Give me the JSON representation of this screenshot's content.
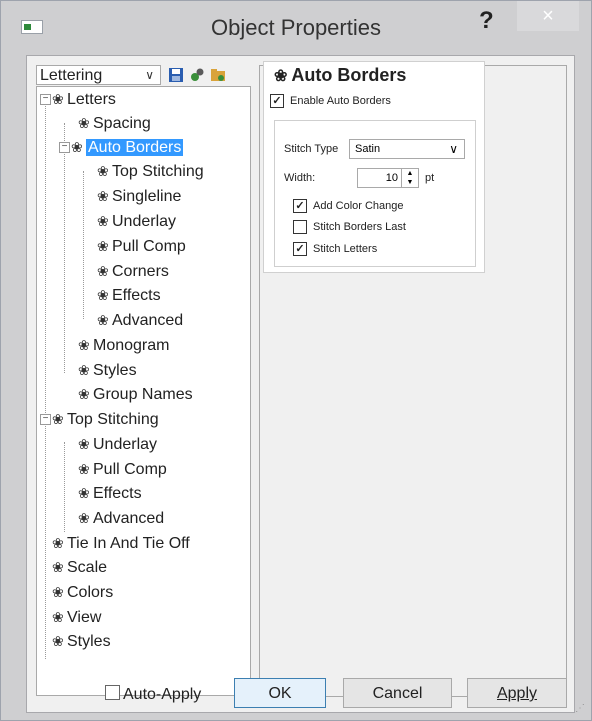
{
  "window": {
    "title": "Object Properties",
    "help": "?",
    "close": "×"
  },
  "left_panel": {
    "combo_value": "Lettering",
    "tree": [
      {
        "label": "Letters",
        "level": 0,
        "expander": "−"
      },
      {
        "label": "Spacing",
        "level": 1
      },
      {
        "label": "Auto Borders",
        "level": 1,
        "expander": "−",
        "selected": true
      },
      {
        "label": "Top Stitching",
        "level": 2
      },
      {
        "label": "Singleline",
        "level": 2
      },
      {
        "label": "Underlay",
        "level": 2
      },
      {
        "label": "Pull Comp",
        "level": 2
      },
      {
        "label": "Corners",
        "level": 2
      },
      {
        "label": "Effects",
        "level": 2
      },
      {
        "label": "Advanced",
        "level": 2
      },
      {
        "label": "Monogram",
        "level": 1
      },
      {
        "label": "Styles",
        "level": 1
      },
      {
        "label": "Group Names",
        "level": 1
      },
      {
        "label": "Top Stitching",
        "level": 0,
        "expander": "−"
      },
      {
        "label": "Underlay",
        "level": 1
      },
      {
        "label": "Pull Comp",
        "level": 1
      },
      {
        "label": "Effects",
        "level": 1
      },
      {
        "label": "Advanced",
        "level": 1
      },
      {
        "label": "Tie In And Tie Off",
        "level": 0
      },
      {
        "label": "Scale",
        "level": 0
      },
      {
        "label": "Colors",
        "level": 0
      },
      {
        "label": "View",
        "level": 0
      },
      {
        "label": "Styles",
        "level": 0
      }
    ]
  },
  "right_panel": {
    "title": "Auto Borders",
    "enable_label": "Enable Auto Borders",
    "enable_checked": true,
    "stitch_type_label": "Stitch Type",
    "stitch_type_value": "Satin",
    "width_label": "Width:",
    "width_value": "10",
    "width_unit": "pt",
    "options": [
      {
        "label": "Add Color Change",
        "checked": true
      },
      {
        "label": "Stitch Borders Last",
        "checked": false
      },
      {
        "label": "Stitch Letters",
        "checked": true
      }
    ]
  },
  "footer": {
    "auto_apply": "Auto-Apply",
    "ok": "OK",
    "cancel": "Cancel",
    "apply": "Apply"
  }
}
